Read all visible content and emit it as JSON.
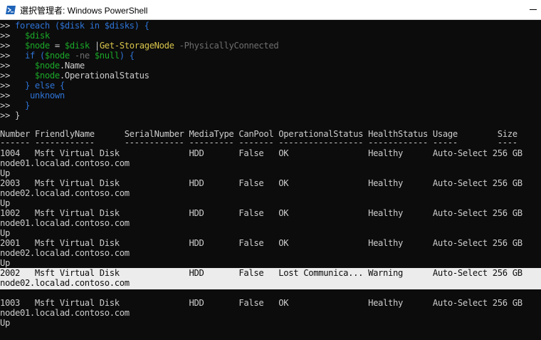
{
  "window": {
    "title": "選択管理者: Windows PowerShell"
  },
  "script_lines": [
    [
      {
        "t": ">> ",
        "c": "prompt"
      },
      {
        "t": "foreach ($disk in $disks) {",
        "c": "kw"
      }
    ],
    [
      {
        "t": ">>   ",
        "c": "prompt"
      },
      {
        "t": "$disk",
        "c": "var"
      }
    ],
    [
      {
        "t": ">>   ",
        "c": "prompt"
      },
      {
        "t": "$node",
        "c": "var"
      },
      {
        "t": " = ",
        "c": "prompt"
      },
      {
        "t": "$disk",
        "c": "var"
      },
      {
        "t": " |",
        "c": "prompt"
      },
      {
        "t": "Get-StorageNode",
        "c": "cmd"
      },
      {
        "t": " -PhysicallyConnected",
        "c": "param"
      }
    ],
    [
      {
        "t": ">>   ",
        "c": "prompt"
      },
      {
        "t": "if (",
        "c": "kw"
      },
      {
        "t": "$node",
        "c": "var"
      },
      {
        "t": " -ne ",
        "c": "param"
      },
      {
        "t": "$null",
        "c": "null"
      },
      {
        "t": ") {",
        "c": "kw"
      }
    ],
    [
      {
        "t": ">>     ",
        "c": "prompt"
      },
      {
        "t": "$node",
        "c": "var"
      },
      {
        "t": ".Name",
        "c": "prompt"
      }
    ],
    [
      {
        "t": ">>     ",
        "c": "prompt"
      },
      {
        "t": "$node",
        "c": "var"
      },
      {
        "t": ".OperationalStatus",
        "c": "prompt"
      }
    ],
    [
      {
        "t": ">>   ",
        "c": "prompt"
      },
      {
        "t": "} else {",
        "c": "kw"
      }
    ],
    [
      {
        "t": ">>   ",
        "c": "prompt"
      },
      {
        "t": " unknown",
        "c": "kw"
      }
    ],
    [
      {
        "t": ">>   ",
        "c": "prompt"
      },
      {
        "t": "}",
        "c": "kw"
      }
    ],
    [
      {
        "t": ">> ",
        "c": "prompt"
      },
      {
        "t": "}",
        "c": "prompt"
      }
    ]
  ],
  "table": {
    "headers": [
      "Number",
      "FriendlyName",
      "SerialNumber",
      "MediaType",
      "CanPool",
      "OperationalStatus",
      "HealthStatus",
      "Usage",
      "Size"
    ],
    "header_line": "Number FriendlyName      SerialNumber MediaType CanPool OperationalStatus HealthStatus Usage        Size",
    "dash_line": "------ ------------      ------------ --------- ------- ----------------- ------------ -----        ----",
    "rows": [
      {
        "line": "1004   Msft Virtual Disk              HDD       False   OK                Healthy      Auto-Select 256 GB",
        "node": "node01.localad.contoso.com",
        "status": "Up",
        "number": "1004",
        "friendly": "Msft Virtual Disk",
        "media": "HDD",
        "canpool": "False",
        "opstatus": "OK",
        "health": "Healthy",
        "usage": "Auto-Select",
        "size": "256 GB"
      },
      {
        "line": "2003   Msft Virtual Disk              HDD       False   OK                Healthy      Auto-Select 256 GB",
        "node": "node02.localad.contoso.com",
        "status": "Up",
        "number": "2003",
        "friendly": "Msft Virtual Disk",
        "media": "HDD",
        "canpool": "False",
        "opstatus": "OK",
        "health": "Healthy",
        "usage": "Auto-Select",
        "size": "256 GB"
      },
      {
        "line": "1002   Msft Virtual Disk              HDD       False   OK                Healthy      Auto-Select 256 GB",
        "node": "node01.localad.contoso.com",
        "status": "Up",
        "number": "1002",
        "friendly": "Msft Virtual Disk",
        "media": "HDD",
        "canpool": "False",
        "opstatus": "OK",
        "health": "Healthy",
        "usage": "Auto-Select",
        "size": "256 GB"
      },
      {
        "line": "2001   Msft Virtual Disk              HDD       False   OK                Healthy      Auto-Select 256 GB",
        "node": "node02.localad.contoso.com",
        "status": "Up",
        "number": "2001",
        "friendly": "Msft Virtual Disk",
        "media": "HDD",
        "canpool": "False",
        "opstatus": "OK",
        "health": "Healthy",
        "usage": "Auto-Select",
        "size": "256 GB"
      },
      {
        "line": "2002   Msft Virtual Disk              HDD       False   Lost Communica... Warning      Auto-Select 256 GB",
        "node": "node02.localad.contoso.com",
        "status": "Up",
        "number": "2002",
        "friendly": "Msft Virtual Disk",
        "media": "HDD",
        "canpool": "False",
        "opstatus": "Lost Communica...",
        "health": "Warning",
        "usage": "Auto-Select",
        "size": "256 GB",
        "selected": true
      },
      {
        "line": "1003   Msft Virtual Disk              HDD       False   OK                Healthy      Auto-Select 256 GB",
        "node": "node01.localad.contoso.com",
        "status": "Up",
        "number": "1003",
        "friendly": "Msft Virtual Disk",
        "media": "HDD",
        "canpool": "False",
        "opstatus": "OK",
        "health": "Healthy",
        "usage": "Auto-Select",
        "size": "256 GB"
      }
    ]
  },
  "colors": {
    "background": "#0c0c0c",
    "text": "#cccccc",
    "keyword": "#2e73d6",
    "variable": "#1aa827",
    "cmdlet": "#d8c44a",
    "parameter": "#6e6e6e",
    "selection": "#ececec"
  },
  "icons": {
    "window": "powershell-icon",
    "minimize": "minimize-icon"
  }
}
